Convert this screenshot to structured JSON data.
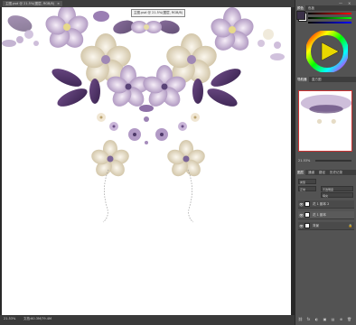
{
  "document": {
    "tab_label": "主图.psd @ 21.5%(图层, RGB/8)",
    "tab_close": "×",
    "cursor_tooltip": "主图.psd @ 21.5%(图层, RGB/8)",
    "zoom": "21.53%",
    "doc_info": "文档:60.3M/79.4M"
  },
  "color_panel": {
    "tabs": [
      "颜色",
      "色板"
    ],
    "foreground": "#3a3048",
    "background": "#ffffff"
  },
  "navigator": {
    "tabs": [
      "导航器",
      "直方图"
    ],
    "zoom": "21.53%"
  },
  "layers_panel": {
    "tabs": [
      "图层",
      "通道",
      "路径",
      "历史记录"
    ],
    "filter_label": "类型",
    "mode": "正常",
    "opacity": "不透明度",
    "fill": "填充",
    "layers": [
      {
        "name": "花 1 副本 2",
        "visible": "👁"
      },
      {
        "name": "花 1 副本",
        "visible": "👁"
      },
      {
        "name": "背景",
        "visible": "👁",
        "lock": "🔒"
      }
    ]
  },
  "window_controls": {
    "minimize": "—",
    "close": "×"
  },
  "bottom_icons": [
    "⛓",
    "fx",
    "◐",
    "▣",
    "▤",
    "⊕",
    "🗑"
  ]
}
